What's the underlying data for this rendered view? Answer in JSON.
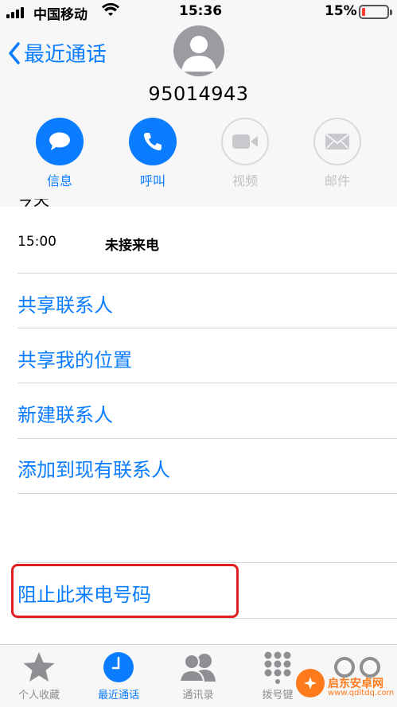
{
  "status_bar": {
    "carrier": "中国移动",
    "time": "15:36",
    "battery_percent": "15%",
    "battery_level": 0.15,
    "battery_color": "#ff3b30"
  },
  "header": {
    "back_label": "最近通话",
    "phone_number": "95014943",
    "actions": [
      {
        "label": "信息",
        "icon": "message-icon",
        "enabled": true
      },
      {
        "label": "呼叫",
        "icon": "phone-icon",
        "enabled": true
      },
      {
        "label": "视频",
        "icon": "video-icon",
        "enabled": false
      },
      {
        "label": "邮件",
        "icon": "mail-icon",
        "enabled": false
      }
    ]
  },
  "recent": {
    "section_label": "今天",
    "call_time": "15:00",
    "call_type": "未接来电"
  },
  "options": [
    "共享联系人",
    "共享我的位置",
    "新建联系人",
    "添加到现有联系人"
  ],
  "block_option": "阻止此来电号码",
  "tabs": [
    {
      "label": "个人收藏",
      "icon": "star-icon",
      "active": false
    },
    {
      "label": "最近通话",
      "icon": "clock-icon",
      "active": true
    },
    {
      "label": "通讯录",
      "icon": "contacts-icon",
      "active": false
    },
    {
      "label": "拨号键",
      "icon": "keypad-icon",
      "active": false
    }
  ],
  "watermark": {
    "text": "启东安卓网",
    "url": "www.qdltdq.com"
  },
  "colors": {
    "accent": "#0a7cff",
    "highlight_box": "#e02020"
  }
}
